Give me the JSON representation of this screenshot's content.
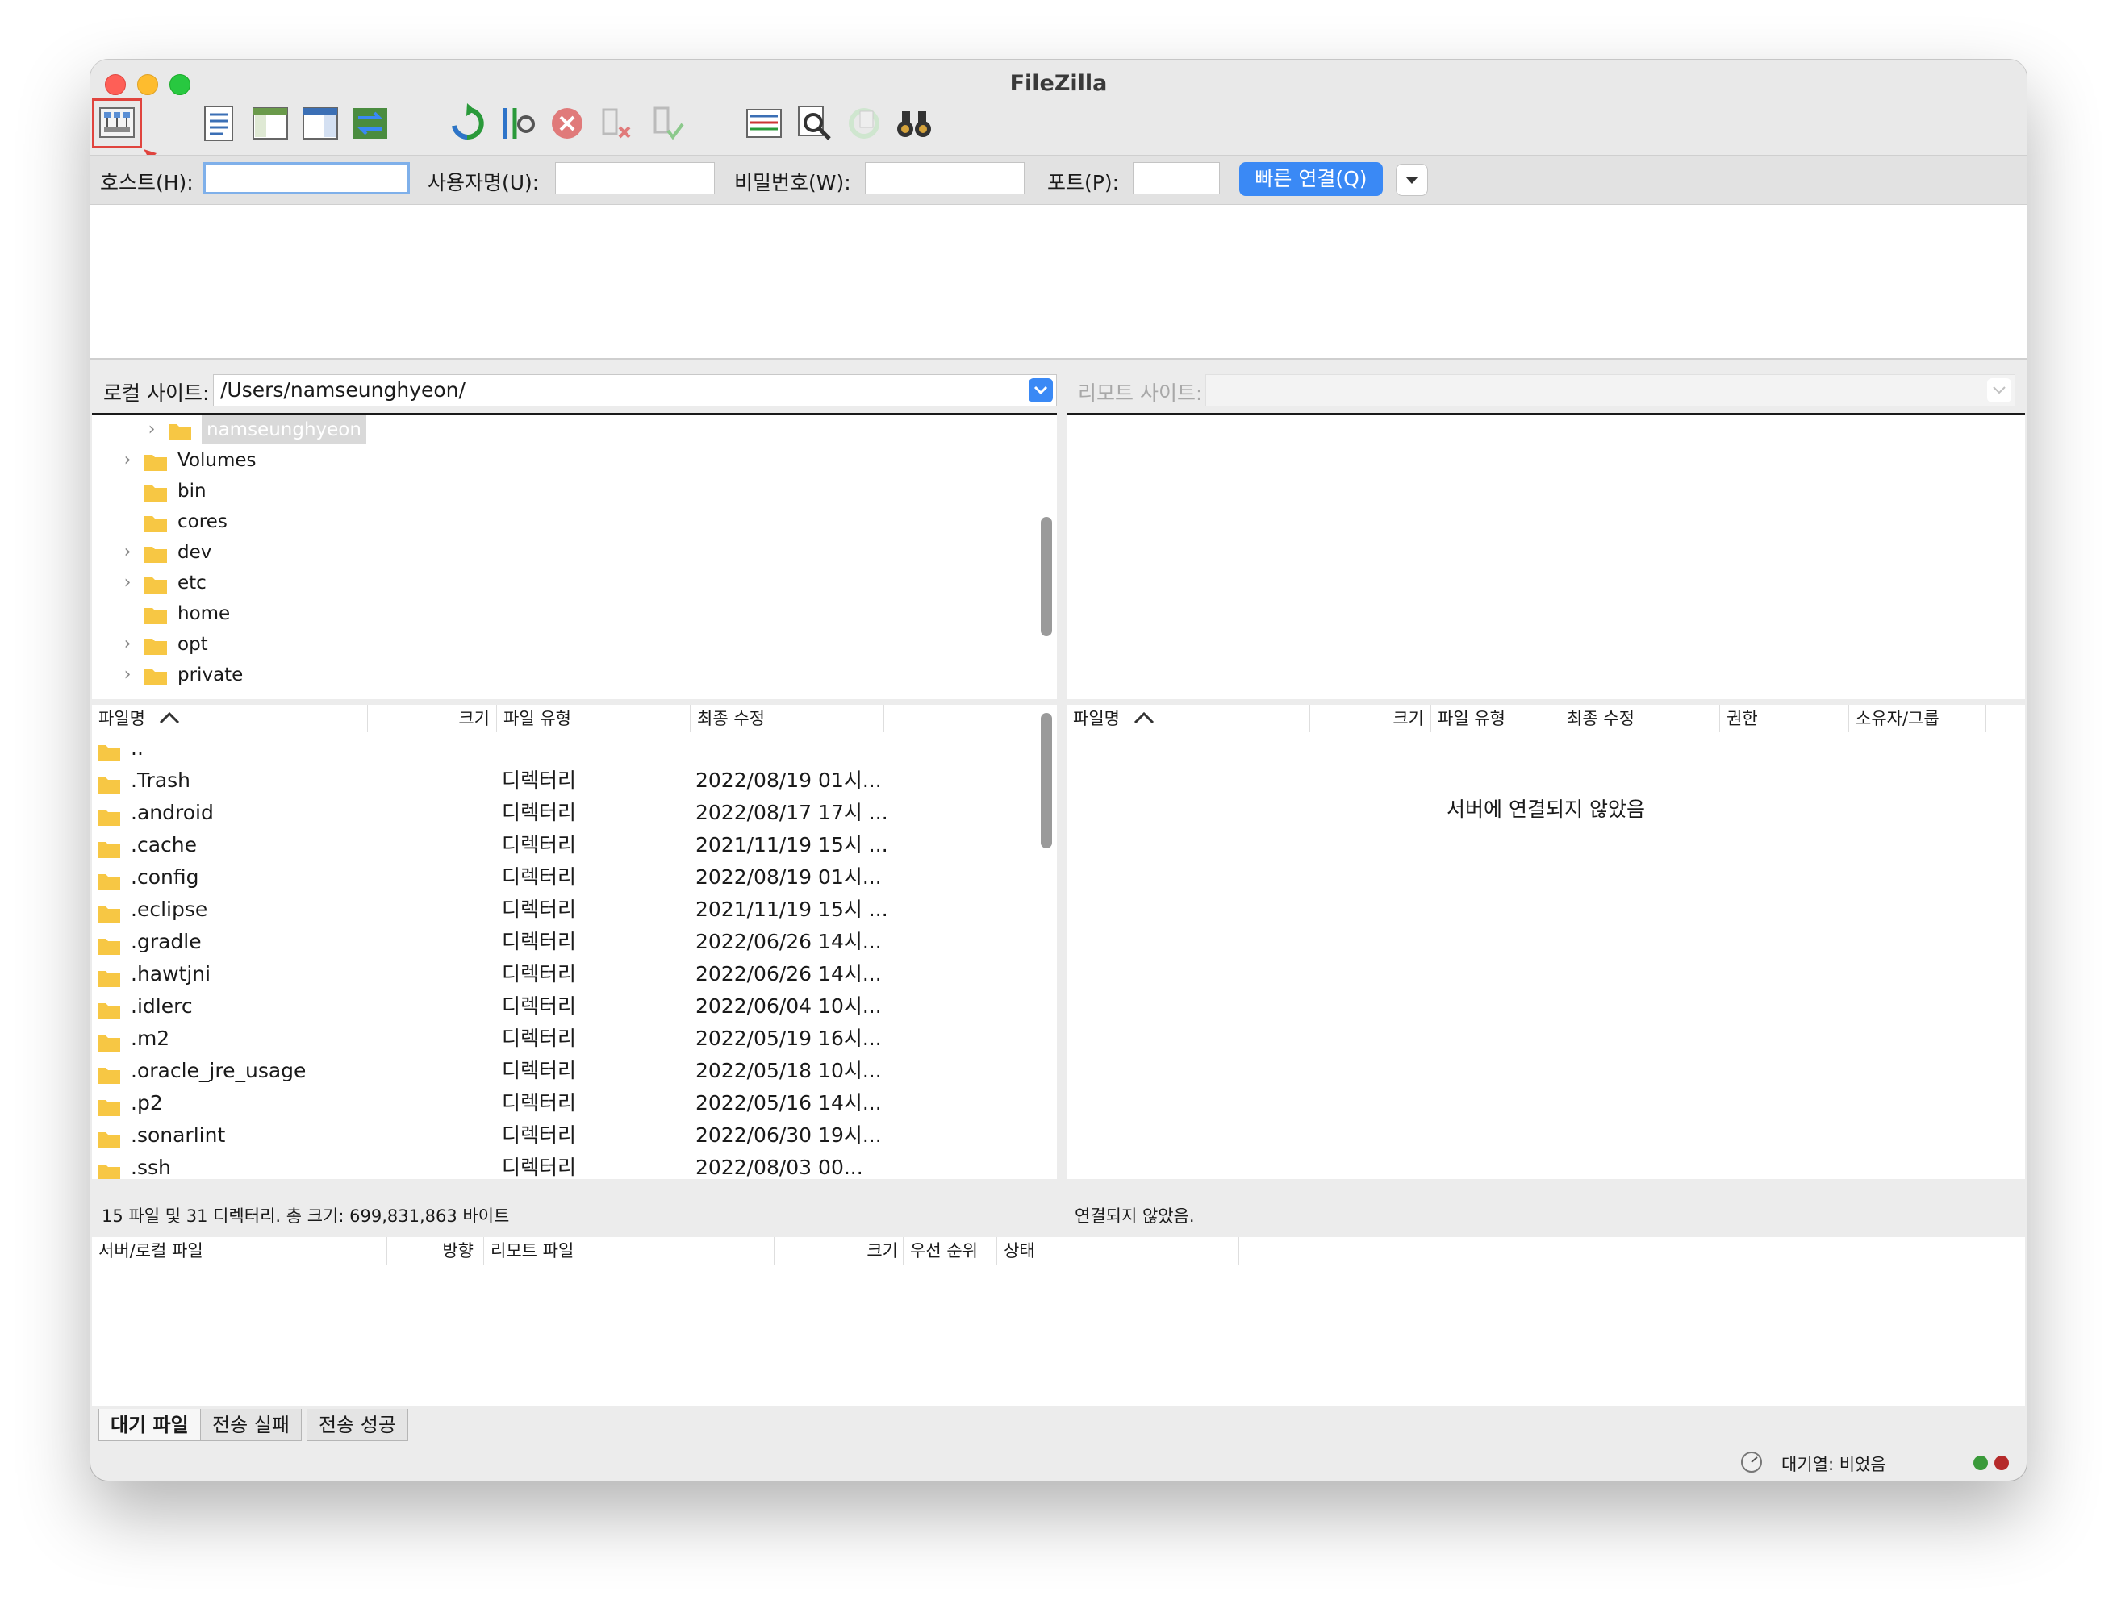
{
  "window": {
    "title": "FileZilla"
  },
  "quickconnect": {
    "host_label": "호스트(H):",
    "host_value": "",
    "user_label": "사용자명(U):",
    "pass_label": "비밀번호(W):",
    "port_label": "포트(P):",
    "connect_label": "빠른 연결(Q)"
  },
  "local": {
    "label": "로컬 사이트:",
    "path": "/Users/namseunghyeon/",
    "tree": [
      {
        "name": "namseunghyeon",
        "expandable": true,
        "selected": true
      },
      {
        "name": "Volumes",
        "expandable": true
      },
      {
        "name": "bin",
        "expandable": false
      },
      {
        "name": "cores",
        "expandable": false
      },
      {
        "name": "dev",
        "expandable": true
      },
      {
        "name": "etc",
        "expandable": true
      },
      {
        "name": "home",
        "expandable": false
      },
      {
        "name": "opt",
        "expandable": true
      },
      {
        "name": "private",
        "expandable": true
      }
    ],
    "columns": [
      "파일명",
      "크기",
      "파일 유형",
      "최종 수정"
    ],
    "files": [
      {
        "name": "..",
        "type": "",
        "modified": ""
      },
      {
        "name": ".Trash",
        "type": "디렉터리",
        "modified": "2022/08/19 01시..."
      },
      {
        "name": ".android",
        "type": "디렉터리",
        "modified": "2022/08/17 17시 ..."
      },
      {
        "name": ".cache",
        "type": "디렉터리",
        "modified": "2021/11/19 15시 ..."
      },
      {
        "name": ".config",
        "type": "디렉터리",
        "modified": "2022/08/19 01시..."
      },
      {
        "name": ".eclipse",
        "type": "디렉터리",
        "modified": "2021/11/19 15시 ..."
      },
      {
        "name": ".gradle",
        "type": "디렉터리",
        "modified": "2022/06/26 14시..."
      },
      {
        "name": ".hawtjni",
        "type": "디렉터리",
        "modified": "2022/06/26 14시..."
      },
      {
        "name": ".idlerc",
        "type": "디렉터리",
        "modified": "2022/06/04 10시..."
      },
      {
        "name": ".m2",
        "type": "디렉터리",
        "modified": "2022/05/19 16시..."
      },
      {
        "name": ".oracle_jre_usage",
        "type": "디렉터리",
        "modified": "2022/05/18 10시..."
      },
      {
        "name": ".p2",
        "type": "디렉터리",
        "modified": "2022/05/16 14시..."
      },
      {
        "name": ".sonarlint",
        "type": "디렉터리",
        "modified": "2022/06/30 19시..."
      },
      {
        "name": ".ssh",
        "type": "디렉터리",
        "modified": "2022/08/03 00..."
      }
    ],
    "status": "15 파일 및 31 디렉터리. 총 크기: 699,831,863 바이트"
  },
  "remote": {
    "label": "리모트 사이트:",
    "path": "",
    "columns": [
      "파일명",
      "크기",
      "파일 유형",
      "최종 수정",
      "권한",
      "소유자/그룹"
    ],
    "empty_message": "서버에 연결되지 않았음",
    "status": "연결되지 않았음."
  },
  "queue": {
    "columns": [
      "서버/로컬 파일",
      "방향",
      "리모트 파일",
      "크기",
      "우선 순위",
      "상태"
    ],
    "tabs": [
      "대기 파일",
      "전송 실패",
      "전송 성공"
    ],
    "status": "대기열: 비었음"
  },
  "colors": {
    "accent": "#3a89f5",
    "folder": "#f7c744",
    "highlight": "#e0443e"
  }
}
